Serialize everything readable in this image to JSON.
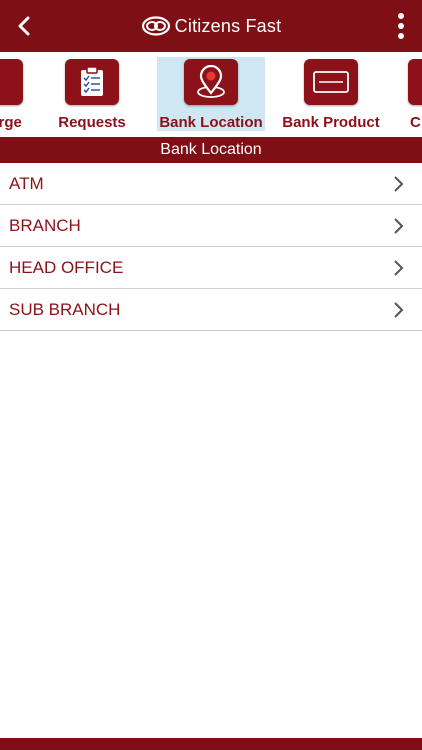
{
  "header": {
    "title": "Citizens Fast",
    "back_icon": "chevron-left-icon",
    "menu_icon": "more-vertical-icon",
    "brand_color": "#7e0f14"
  },
  "tabs": [
    {
      "label": "arge",
      "icon": "recharge-icon",
      "active": false
    },
    {
      "label": "Requests",
      "icon": "checklist-icon",
      "active": false
    },
    {
      "label": "Bank Location",
      "icon": "map-pin-icon",
      "active": true
    },
    {
      "label": "Bank Product",
      "icon": "card-icon",
      "active": false
    },
    {
      "label": "C",
      "icon": "partial-icon",
      "active": false
    }
  ],
  "section": {
    "title": "Bank Location"
  },
  "list": {
    "items": [
      {
        "label": "ATM"
      },
      {
        "label": "BRANCH"
      },
      {
        "label": "HEAD OFFICE"
      },
      {
        "label": "SUB BRANCH"
      }
    ]
  },
  "colors": {
    "accent": "#8c1118",
    "active_tab_bg": "#cfe7f2",
    "divider": "#cfcfcf"
  }
}
